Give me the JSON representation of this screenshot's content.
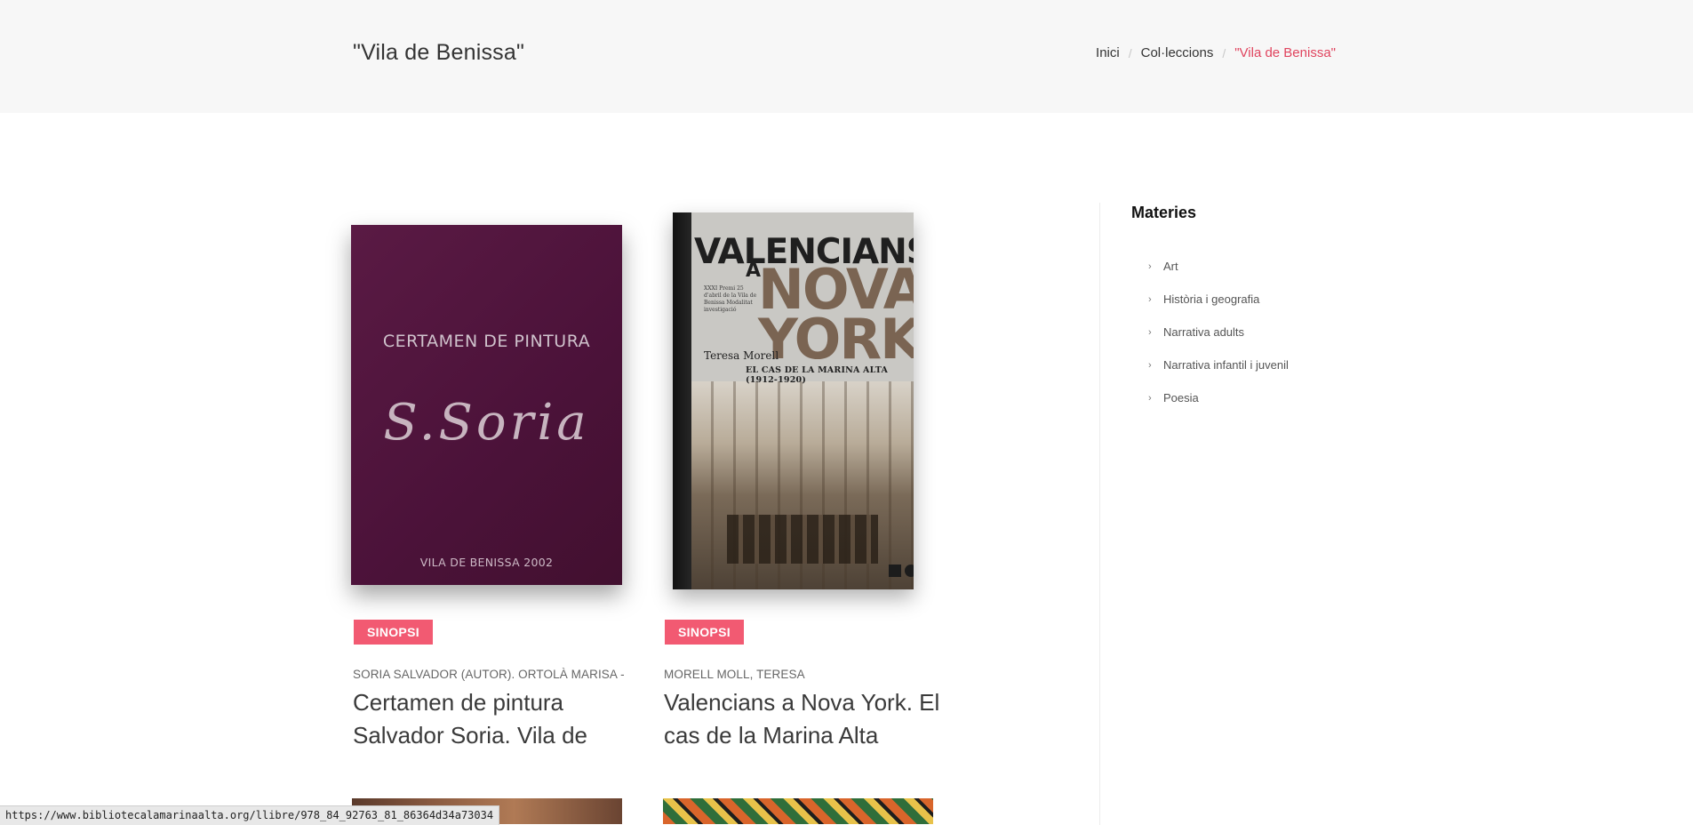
{
  "header": {
    "title": "\"Vila de Benissa\"",
    "breadcrumb": [
      "Inici",
      "Col·leccions",
      "\"Vila de Benissa\""
    ]
  },
  "sidebar": {
    "title": "Materies",
    "items": [
      "Art",
      "Història i geografia",
      "Narrativa adults",
      "Narrativa infantil i juvenil",
      "Poesia"
    ]
  },
  "books": [
    {
      "badge": "SINOPSI",
      "author": "SORIA SALVADOR (AUTOR). ORTOLÀ MARISA -",
      "title": "Certamen de pintura Salvador Soria. Vila de",
      "cover": {
        "heading": "CERTAMEN DE PINTURA",
        "signature": "S.Soria",
        "footer": "VILA DE BENISSA 2002"
      }
    },
    {
      "badge": "SINOPSI",
      "author": "MORELL MOLL, TERESA",
      "title": "Valencians a Nova York. El cas de la Marina Alta",
      "cover": {
        "line1": "VALENCIANS",
        "line2": "A",
        "line3": "NOVA",
        "line4": "YORK",
        "prize": "XXXI Premi 25 d'abril de la Vila de Benissa Modalitat investigació",
        "author": "Teresa Morell",
        "subtitle": "EL CAS DE LA MARINA ALTA (1912-1920)"
      }
    }
  ],
  "status_bar": "https://www.bibliotecalamarinaalta.org/llibre/978_84_92763_81_86364d34a73034",
  "colors": {
    "accent": "#e0445e",
    "badge": "#f25a72",
    "header_bg": "#f7f7f7"
  }
}
